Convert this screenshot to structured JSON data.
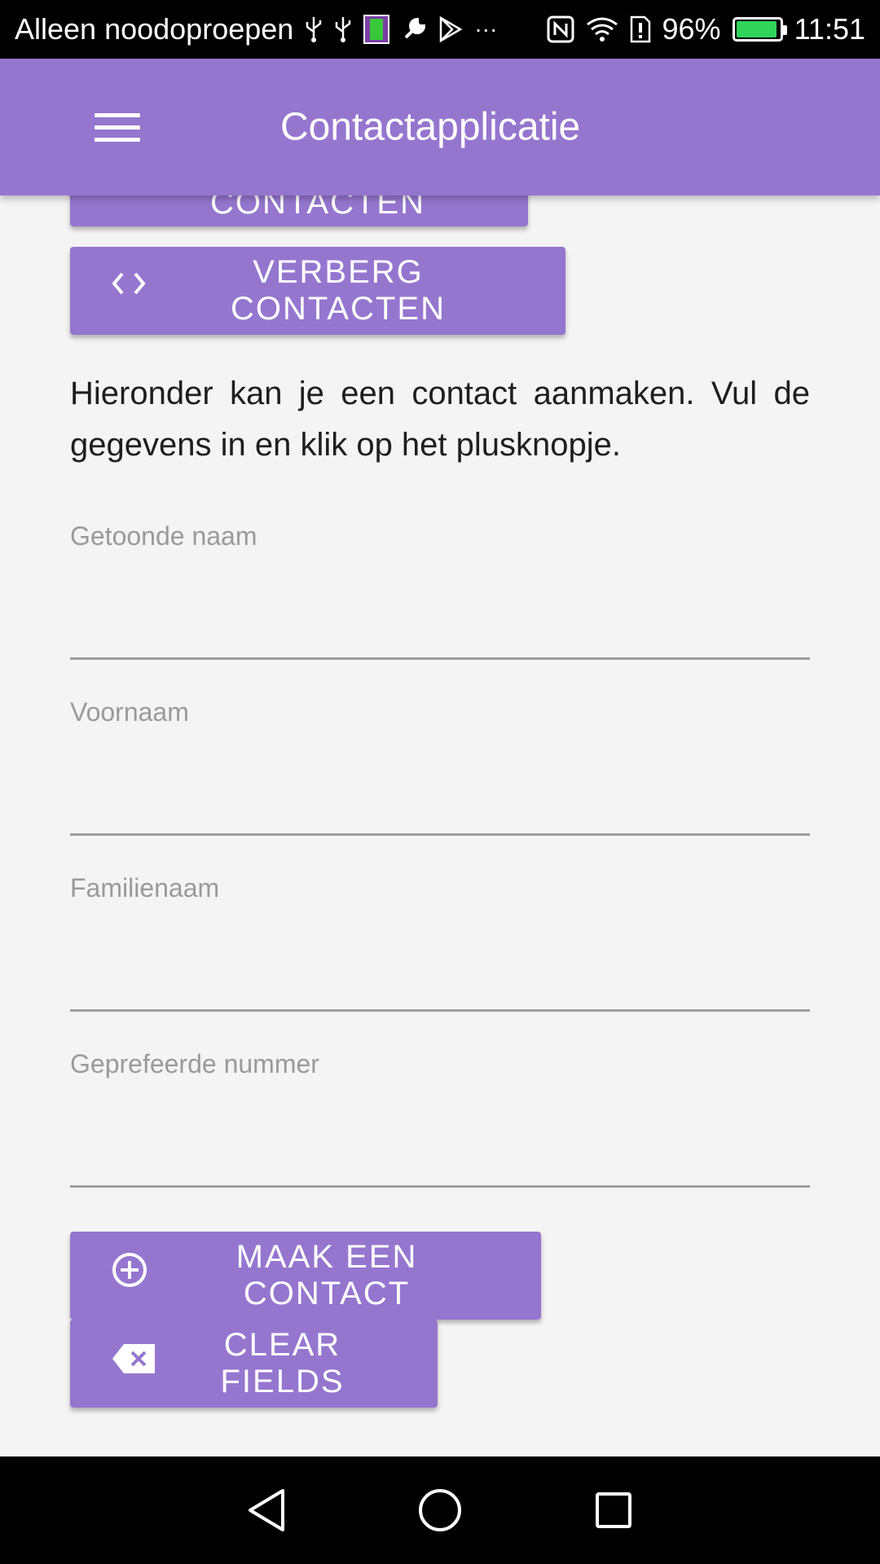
{
  "status_bar": {
    "carrier_text": "Alleen noodoproepen",
    "battery_percent": "96%",
    "battery_level": 0.96,
    "time": "11:51",
    "overflow_dots": "···"
  },
  "app_bar": {
    "title": "Contactapplicatie"
  },
  "buttons": {
    "bekijk": "BEKIJK CONTACTEN",
    "verberg": "VERBERG CONTACTEN",
    "maak": "MAAK EEN CONTACT",
    "clear": "CLEAR FIELDS"
  },
  "intro_text": "Hieronder kan je een contact aanmaken. Vul de gegevens in en klik op het plusknopje.",
  "fields": [
    {
      "label": "Getoonde naam",
      "value": ""
    },
    {
      "label": "Voornaam",
      "value": ""
    },
    {
      "label": "Familienaam",
      "value": ""
    },
    {
      "label": "Geprefeerde nummer",
      "value": ""
    }
  ],
  "colors": {
    "primary": "#9576cf",
    "background": "#f4f4f4",
    "battery_green": "#31d45a"
  }
}
